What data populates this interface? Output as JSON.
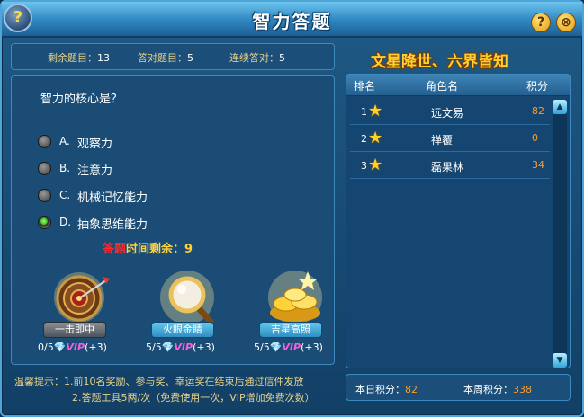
{
  "window": {
    "title": "智力答题",
    "corner_icon": "?",
    "help_label": "?",
    "close_label": "⊗"
  },
  "stats": {
    "remaining_label": "剩余题目：",
    "remaining_value": "13",
    "correct_label": "答对题目：",
    "correct_value": "5",
    "streak_label": "连续答对：",
    "streak_value": "5"
  },
  "question": {
    "text": "智力的核心是？",
    "options": [
      {
        "letter": "A.",
        "text": "观察力",
        "selected": false
      },
      {
        "letter": "B.",
        "text": "注意力",
        "selected": false
      },
      {
        "letter": "C.",
        "text": "机械记忆能力",
        "selected": false
      },
      {
        "letter": "D.",
        "text": "抽象思维能力",
        "selected": true
      }
    ],
    "timer_red": "答题",
    "timer_label": "时间剩余：",
    "timer_value": "9"
  },
  "tools": [
    {
      "name": "一击即中",
      "count": "0/5",
      "gem": "💎",
      "vip": "VIP",
      "bonus": "(+3)",
      "icon": "dartboard-icon"
    },
    {
      "name": "火眼金睛",
      "count": "5/5",
      "gem": "💎",
      "vip": "VIP",
      "bonus": "(+3)",
      "icon": "magnifier-icon"
    },
    {
      "name": "吉星高照",
      "count": "5/5",
      "gem": "💎",
      "vip": "VIP",
      "bonus": "(+3)",
      "icon": "gold-ingot-icon"
    }
  ],
  "tips": {
    "line1": "温馨提示：1.前10名奖励、参与奖、幸运奖在结束后通过信件发放",
    "line2": "2.答题工具5两/次（免费使用一次，VIP增加免费次数）"
  },
  "ranking": {
    "motto": "文星降世、六界皆知",
    "headers": {
      "rank": "排名",
      "name": "角色名",
      "score": "积分"
    },
    "rows": [
      {
        "rank": "1",
        "name": "远文易",
        "score": "82"
      },
      {
        "rank": "2",
        "name": "禅覆",
        "score": "0"
      },
      {
        "rank": "3",
        "name": "磊果林",
        "score": "34"
      }
    ]
  },
  "scores": {
    "today_label": "本日积分：",
    "today_value": "82",
    "week_label": "本周积分：",
    "week_value": "338"
  },
  "colors": {
    "accent_gold": "#ffcf2e",
    "score_orange": "#ff9a2a",
    "timer_red": "#ff2a2a"
  }
}
